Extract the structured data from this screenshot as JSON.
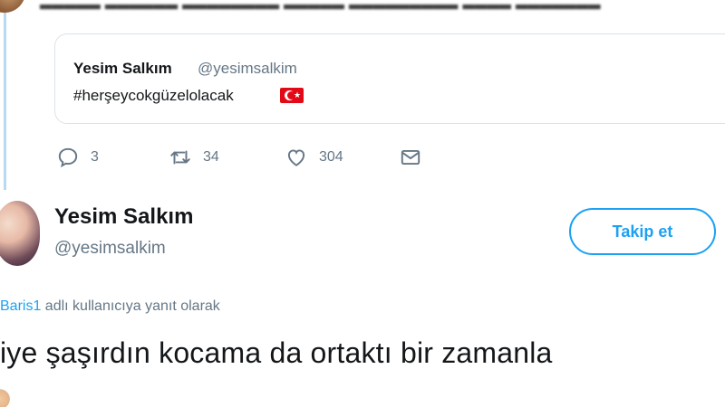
{
  "quoted_tweet": {
    "display_name": "Yesim Salkım",
    "handle": "@yesimsalkim",
    "text": "#herşeycokgüzelolacak",
    "emoji": "turkey-flag"
  },
  "actions": {
    "reply_count": "3",
    "retweet_count": "34",
    "like_count": "304"
  },
  "reply_tweet": {
    "display_name": "Yesim Salkım",
    "handle": "@yesimsalkim",
    "follow_label": "Takip et",
    "reply_to_mention": "Baris1",
    "reply_to_suffix": " adlı kullanıcıya yanıt olarak",
    "text": "iye şaşırdın kocama da ortaktı bir zamanla"
  },
  "colors": {
    "accent": "#1da1f2",
    "secondary_text": "#657786",
    "thread_line": "#b8d9f2",
    "flag_red": "#e30a17"
  }
}
